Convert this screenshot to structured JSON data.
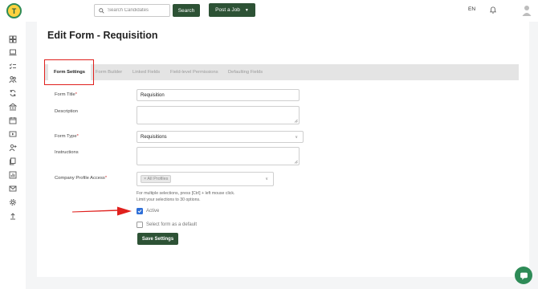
{
  "header": {
    "logo_letter": "T",
    "search": {
      "placeholder": "Search Candidates",
      "value": ""
    },
    "search_label": "Search",
    "post_job_label": "Post a Job",
    "language": "EN",
    "brand_color": "#2d5235"
  },
  "sidebar": {
    "icons": [
      "dashboard-icon",
      "laptop-icon",
      "checklist-icon",
      "users-icon",
      "sync-icon",
      "building-icon",
      "calendar-icon",
      "video-icon",
      "user-add-icon",
      "documents-icon",
      "reports-icon",
      "mail-icon",
      "gear-icon",
      "upload-icon"
    ]
  },
  "page": {
    "title": "Edit Form - Requisition"
  },
  "tabs": [
    {
      "label": "Form Settings",
      "active": true
    },
    {
      "label": "Form Builder",
      "active": false
    },
    {
      "label": "Linked Fields",
      "active": false
    },
    {
      "label": "Field-level Permissions",
      "active": false
    },
    {
      "label": "Defaulting Fields",
      "active": false
    }
  ],
  "form": {
    "title_label": "Form Title",
    "title_value": "Requisition",
    "description_label": "Description",
    "description_value": "",
    "type_label": "Form Type",
    "type_value": "Requisitions",
    "instructions_label": "Instructions",
    "instructions_value": "",
    "access_label": "Company Profile Access",
    "access_tag": "× All Profiles",
    "hint_line1": "For multiple selections, press [Ctrl] + left mouse click.",
    "hint_line2": "Limit your selections to 30 options.",
    "active_label": "Active",
    "active_checked": true,
    "default_label": "Select form as a default",
    "default_checked": false,
    "save_label": "Save Settings",
    "required_marker": "*"
  },
  "colors": {
    "accent": "#2e6fd8",
    "annotation": "#e0201d",
    "chat": "#2e8b57"
  }
}
